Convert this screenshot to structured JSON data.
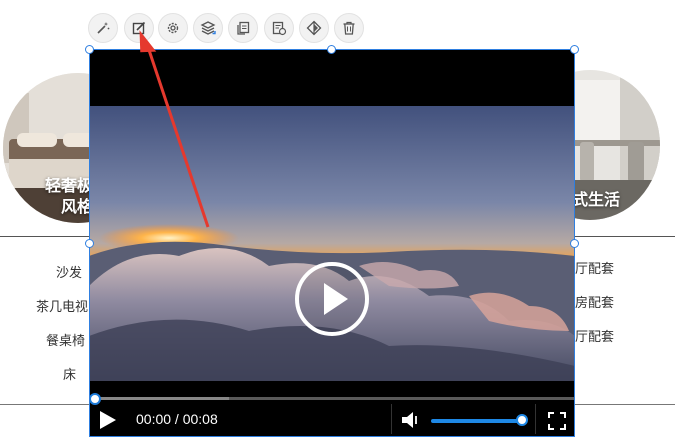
{
  "background": {
    "left_card_title_line1": "轻奢极",
    "left_card_title_line2": "风格",
    "right_card_title": "式生活",
    "left_menu": [
      "沙发",
      "茶几电视",
      "餐桌椅",
      "床"
    ],
    "right_menu": [
      "厅配套",
      "房配套",
      "厅配套"
    ]
  },
  "toolbar": {
    "buttons": [
      {
        "name": "magic-wand-button",
        "icon": "magic-wand-icon"
      },
      {
        "name": "edit-button",
        "icon": "edit-icon"
      },
      {
        "name": "settings-button",
        "icon": "gear-icon"
      },
      {
        "name": "layers-button",
        "icon": "layers-icon"
      },
      {
        "name": "copy-button",
        "icon": "copy-icon"
      },
      {
        "name": "replace-button",
        "icon": "replace-icon"
      },
      {
        "name": "flip-button",
        "icon": "flip-icon"
      },
      {
        "name": "delete-button",
        "icon": "trash-icon"
      }
    ]
  },
  "video": {
    "time_display": "00:00 / 00:08",
    "progress": 0,
    "volume": 1
  },
  "colors": {
    "selection": "#2f7fe0",
    "accent": "#1e88e5",
    "arrow": "#e5392e"
  }
}
